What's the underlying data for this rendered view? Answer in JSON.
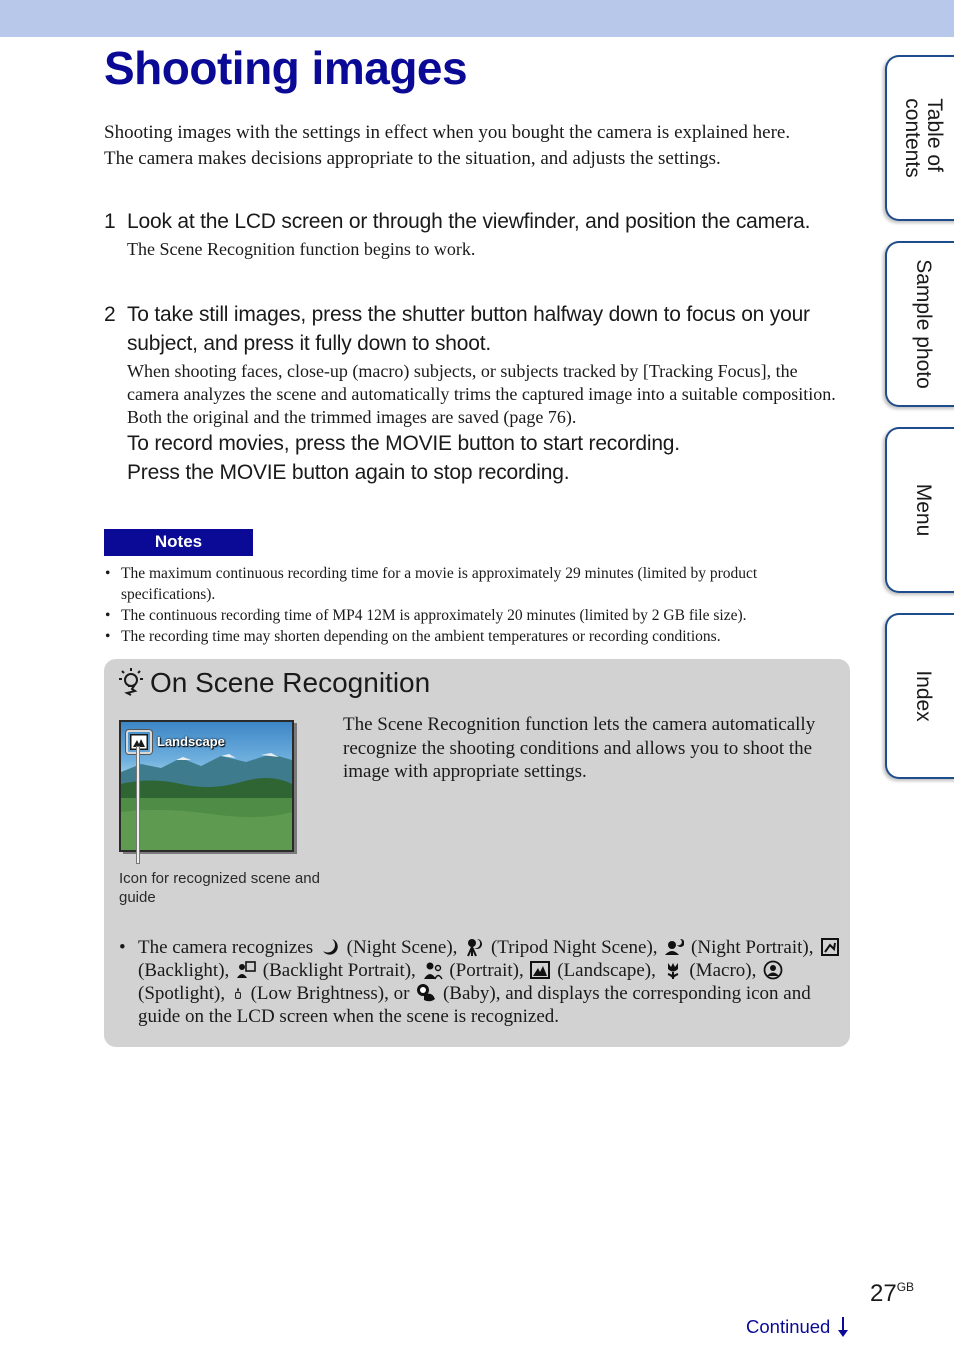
{
  "page": {
    "title": "Shooting images",
    "intro": [
      "Shooting images with the settings in effect when you bought the camera is explained here.",
      "The camera makes decisions appropriate to the situation, and adjusts the settings."
    ],
    "steps": [
      {
        "number": "1",
        "heading": "Look at the LCD screen or through the viewfinder, and position the camera.",
        "body": "The Scene Recognition function begins to work."
      },
      {
        "number": "2",
        "heading": "To take still images, press the shutter button halfway down to focus on your subject, and press it fully down to shoot.",
        "body": "When shooting faces, close-up (macro) subjects, or subjects tracked by [Tracking Focus], the camera analyzes the scene and automatically trims the captured image into a suitable composition. Both the original and the trimmed images are saved (page 76).",
        "extra": [
          "To record movies, press the MOVIE button to start recording.",
          "Press the MOVIE button again to stop recording."
        ]
      }
    ],
    "notes": {
      "label": "Notes",
      "items": [
        "The maximum continuous recording time for a movie is approximately 29 minutes (limited by product specifications).",
        "The continuous recording time of MP4 12M is approximately 20 minutes (limited by 2 GB file size).",
        "The recording time may shorten depending on the ambient temperatures or recording conditions."
      ]
    },
    "tip": {
      "icon": "lightbulb-icon",
      "title": "On Scene Recognition",
      "lcd_label": "Landscape",
      "caption": "Icon for recognized scene and guide",
      "description": "The Scene Recognition function lets the camera automatically recognize the shooting conditions and allows you to shoot the image with appropriate settings.",
      "scenes_intro": "The camera recognizes",
      "scenes": [
        {
          "icon": "night-scene-icon",
          "label": "(Night Scene),"
        },
        {
          "icon": "tripod-night-scene-icon",
          "label": "(Tripod Night Scene),"
        },
        {
          "icon": "night-portrait-icon",
          "label": "(Night Portrait),"
        },
        {
          "icon": "backlight-icon",
          "label": "(Backlight),"
        },
        {
          "icon": "backlight-portrait-icon",
          "label": "(Backlight Portrait),"
        },
        {
          "icon": "portrait-icon",
          "label": "(Portrait),"
        },
        {
          "icon": "landscape-icon",
          "label": "(Landscape),"
        },
        {
          "icon": "macro-icon",
          "label": "(Macro),"
        },
        {
          "icon": "spotlight-icon",
          "label": "(Spotlight),"
        },
        {
          "icon": "low-brightness-icon",
          "label": "(Low Brightness), or"
        },
        {
          "icon": "baby-icon",
          "label": "(Baby),"
        }
      ],
      "scenes_outro": "and displays the corresponding icon and guide on the LCD screen when the scene is recognized."
    },
    "side_tabs": [
      {
        "label_line1": "Table of",
        "label_line2": "contents"
      },
      {
        "label_line1": "Sample photo",
        "label_line2": ""
      },
      {
        "label_line1": "Menu",
        "label_line2": ""
      },
      {
        "label_line1": "Index",
        "label_line2": ""
      }
    ],
    "footer": {
      "page_number": "27",
      "page_suffix": "GB",
      "continued": "Continued"
    },
    "colors": {
      "accent": "#0a0a96",
      "top_band": "#b8c8ea",
      "tip_background": "#d2d2d2",
      "tab_border": "#1e4c8c"
    }
  }
}
